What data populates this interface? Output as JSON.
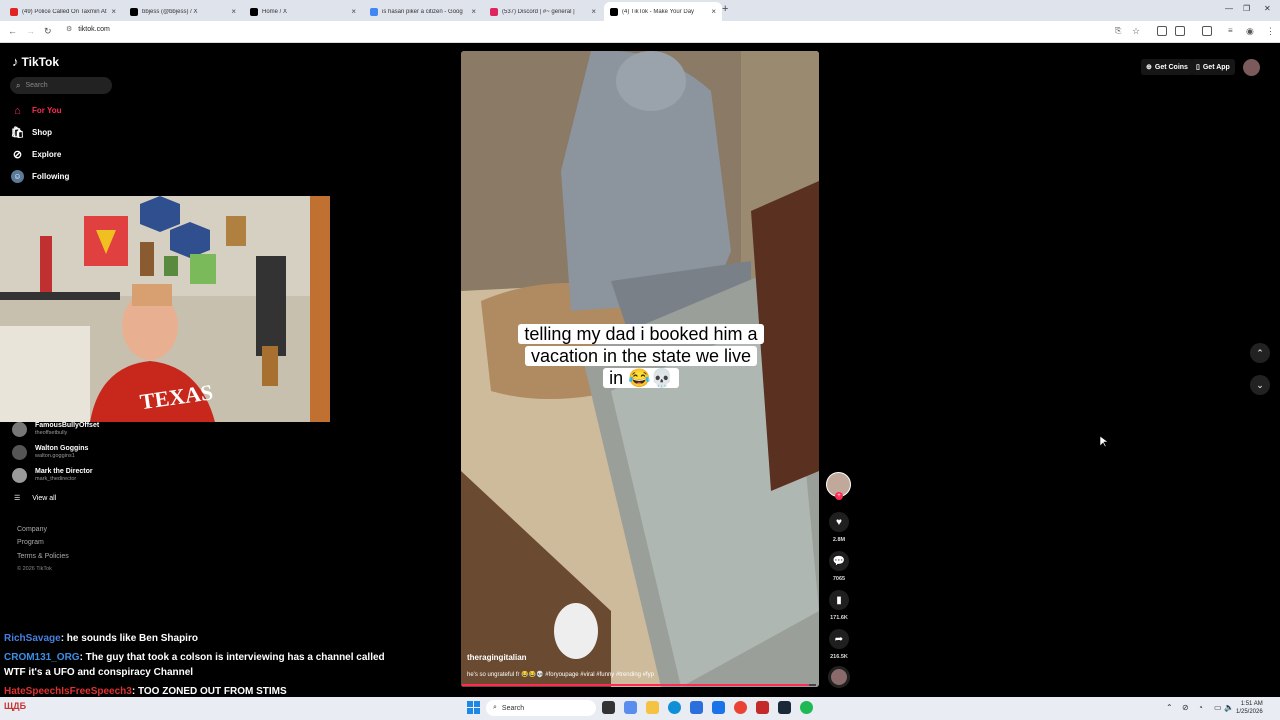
{
  "browser": {
    "tabs": [
      {
        "title": "(49) Police Called On Taxmin At",
        "color": "#e02424",
        "active": false
      },
      {
        "title": "bbjess (@bbjess) / X",
        "color": "#000000",
        "active": false
      },
      {
        "title": "Home / X",
        "color": "#000000",
        "active": false
      },
      {
        "title": "is hasan piker a citizen - Goog",
        "color": "#4285f4",
        "active": false
      },
      {
        "title": "(537) Discord | #~ general |",
        "color": "#e0245e",
        "active": false
      },
      {
        "title": "(4) TikTok - Make Your Day",
        "color": "#000000",
        "active": true
      }
    ],
    "url": "tiktok.com",
    "new_tab_label": "+"
  },
  "tiktok": {
    "logo_text": "TikTok",
    "search_placeholder": "Search",
    "nav": [
      {
        "label": "For You",
        "icon": "home-icon",
        "active": true
      },
      {
        "label": "Shop",
        "icon": "shop-bag-icon",
        "active": false
      },
      {
        "label": "Explore",
        "icon": "compass-icon",
        "active": false
      },
      {
        "label": "Following",
        "icon": "following-avatar-icon",
        "active": false
      }
    ],
    "following_accounts": [
      {
        "name": "FamousBullyOffset",
        "handle": "theoffsetbully"
      },
      {
        "name": "Walton Goggins",
        "handle": "walton.goggins1"
      },
      {
        "name": "Mark the Director",
        "handle": "mark_thedirector"
      }
    ],
    "view_all_label": "View all",
    "footer_links": [
      "Company",
      "Program",
      "Terms & Policies"
    ],
    "copyright": "© 2026 TikTok",
    "top_actions": {
      "get_coins": "Get Coins",
      "get_app": "Get App"
    },
    "video": {
      "caption_lines": [
        "telling my dad i booked him a",
        "vacation in the state we live",
        "in 😂💀"
      ],
      "username": "theragingitalian",
      "description": "he's so ungrateful fr 😂😂💀 #foryoupage #viral #funny #trending #fyp",
      "progress": 0.98
    },
    "actions": {
      "likes": "2.8M",
      "comments": "7065",
      "saves": "171.6K",
      "shares": "216.5K"
    },
    "accent_color": "#fe2c55"
  },
  "chat": [
    {
      "user": "RichSavage",
      "message": ": he sounds like Ben Shapiro"
    },
    {
      "user": "CROM131_ORG",
      "message": ": The guy that took a colson is interviewing has a channel called"
    },
    {
      "user": "",
      "message": "WTF it's a UFO and conspiracy Channel"
    },
    {
      "user": "HateSpeechIsFreeSpeech3",
      "message": ": TOO ZONED OUT FROM STIMS"
    }
  ],
  "taskbar": {
    "search_label": "Search",
    "time": "1:51 AM",
    "date": "1/25/2026",
    "weather_label": "ЩДБ"
  }
}
